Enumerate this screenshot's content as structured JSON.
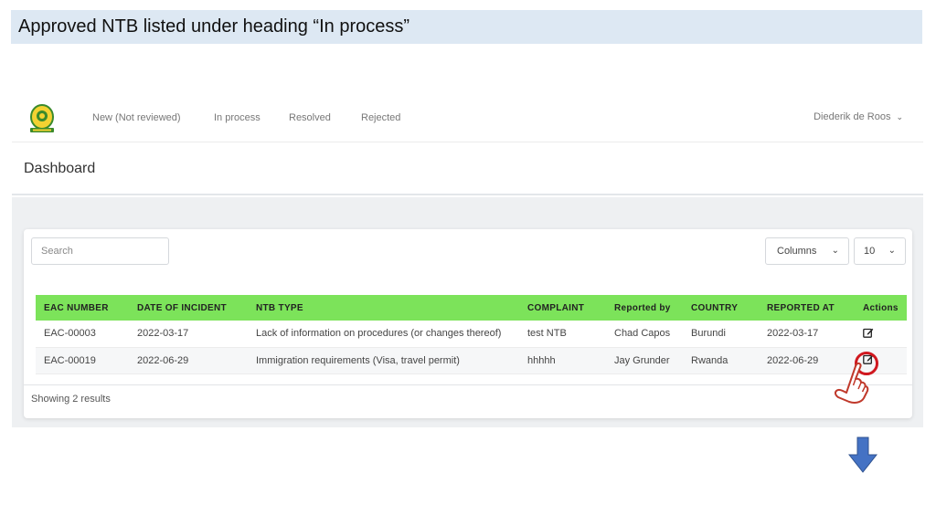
{
  "slide": {
    "title": "Approved NTB listed under heading “In process”"
  },
  "nav": {
    "links": [
      "New (Not reviewed)",
      "In process",
      "Resolved",
      "Rejected"
    ],
    "user": "Diederik de Roos"
  },
  "dashboard": {
    "title": "Dashboard"
  },
  "toolbar": {
    "search_placeholder": "Search",
    "columns_label": "Columns",
    "page_size": "10"
  },
  "table": {
    "headers": [
      "EAC NUMBER",
      "DATE OF INCIDENT",
      "NTB TYPE",
      "COMPLAINT",
      "Reported by",
      "COUNTRY",
      "REPORTED AT",
      "Actions"
    ],
    "rows": [
      {
        "eac": "EAC-00003",
        "date": "2022-03-17",
        "type": "Lack of information on procedures (or changes thereof)",
        "complaint": "test NTB",
        "reporter": "Chad Capos",
        "country": "Burundi",
        "reported_at": "2022-03-17"
      },
      {
        "eac": "EAC-00019",
        "date": "2022-06-29",
        "type": "Immigration requirements (Visa, travel permit)",
        "complaint": "hhhhh",
        "reporter": "Jay Grunder",
        "country": "Rwanda",
        "reported_at": "2022-06-29"
      }
    ]
  },
  "footer": {
    "showing": "Showing 2 results"
  },
  "colors": {
    "header_green": "#7ce35a",
    "title_band": "#dde8f3",
    "annotation_red": "#d0181f",
    "arrow_blue": "#4472c4"
  },
  "icons": [
    "edit-icon",
    "pointing-hand-icon",
    "down-arrow-icon",
    "eac-logo"
  ]
}
